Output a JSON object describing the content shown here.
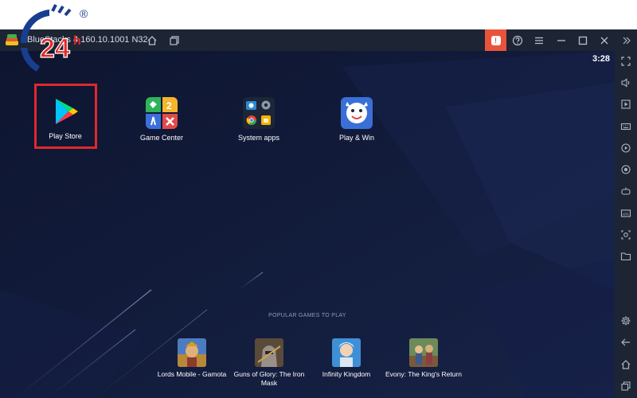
{
  "titlebar": {
    "title": "BlueStacks 4.160.10.1001 N32",
    "notification_count": "!"
  },
  "screen": {
    "clock": "3:28",
    "apps": [
      {
        "label": "Play Store",
        "icon": "play-store-icon"
      },
      {
        "label": "Game Center",
        "icon": "game-center-icon"
      },
      {
        "label": "System apps",
        "icon": "system-apps-icon"
      },
      {
        "label": "Play & Win",
        "icon": "play-and-win-icon"
      }
    ],
    "popular_title": "POPULAR GAMES TO PLAY",
    "games": [
      {
        "label": "Lords Mobile - Gamota"
      },
      {
        "label": "Guns of Glory: The Iron Mask"
      },
      {
        "label": "Infinity Kingdom"
      },
      {
        "label": "Evony: The King's Return"
      }
    ]
  },
  "watermark": {
    "text": "24h",
    "mark": "®"
  },
  "colors": {
    "titlebar_bg": "#1d2434",
    "screen_bg": "#0e1733",
    "notification_accent": "#e9533b",
    "highlight_border": "#e0282c"
  }
}
